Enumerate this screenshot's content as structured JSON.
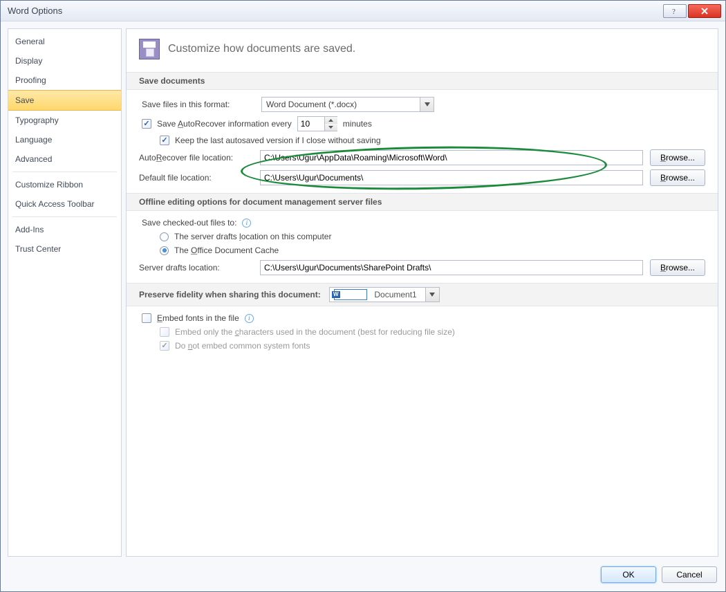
{
  "window": {
    "title": "Word Options"
  },
  "sidebar": {
    "items": [
      "General",
      "Display",
      "Proofing",
      "Save",
      "Typography",
      "Language",
      "Advanced",
      "Customize Ribbon",
      "Quick Access Toolbar",
      "Add-Ins",
      "Trust Center"
    ],
    "selected_index": 3
  },
  "header": {
    "text": "Customize how documents are saved."
  },
  "sections": {
    "save_documents": {
      "title": "Save documents",
      "format_label": "Save files in this format:",
      "format_value": "Word Document (*.docx)",
      "autorecover_label_pre": "Save ",
      "autorecover_label_u": "A",
      "autorecover_label_post": "utoRecover information every",
      "autorecover_minutes": "10",
      "autorecover_unit": "minutes",
      "keep_last_label": "Keep the last autosaved version if I close without saving",
      "autorecover_loc_label": "AutoRecover file location:",
      "autorecover_loc_value": "C:\\Users\\Ugur\\AppData\\Roaming\\Microsoft\\Word\\",
      "default_loc_label": "Default file location:",
      "default_loc_value": "C:\\Users\\Ugur\\Documents\\",
      "browse_label": "Browse..."
    },
    "offline": {
      "title": "Offline editing options for document management server files",
      "save_checked_label": "Save checked-out files to:",
      "radio1": "The server drafts location on this computer",
      "radio2": "The Office Document Cache",
      "server_drafts_label": "Server drafts location:",
      "server_drafts_value": "C:\\Users\\Ugur\\Documents\\SharePoint Drafts\\",
      "browse_label": "Browse..."
    },
    "preserve": {
      "title": "Preserve fidelity when sharing this document:",
      "doc_value": "Document1",
      "embed_fonts": "Embed fonts in the file",
      "embed_chars": "Embed only the characters used in the document (best for reducing file size)",
      "no_common": "Do not embed common system fonts"
    }
  },
  "buttons": {
    "ok": "OK",
    "cancel": "Cancel"
  }
}
